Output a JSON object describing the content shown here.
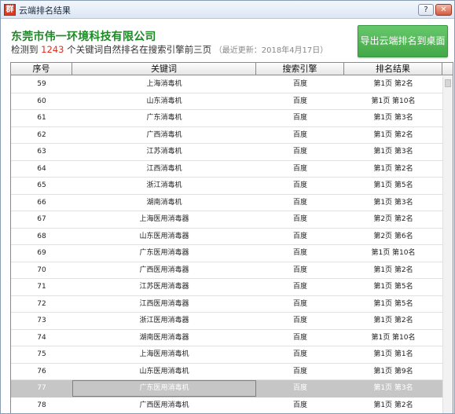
{
  "window": {
    "title": "云端排名结果",
    "app_icon_glyph": "群",
    "help_label": "?",
    "close_label": "✕"
  },
  "header": {
    "company": "东莞市伟一环境科技有限公司",
    "sub_prefix": "检测到",
    "keyword_count": "1243",
    "sub_suffix": "个关键词自然排名在搜索引擎前三页",
    "updated": "（最近更新：2018年4月17日）",
    "export_label": "导出云端排名到桌面"
  },
  "table": {
    "columns": [
      "序号",
      "关键词",
      "搜索引擎",
      "排名结果"
    ],
    "selected_index": 18,
    "rows": [
      [
        "59",
        "上海消毒机",
        "百度",
        "第1页 第2名"
      ],
      [
        "60",
        "山东消毒机",
        "百度",
        "第1页 第10名"
      ],
      [
        "61",
        "广东消毒机",
        "百度",
        "第1页 第3名"
      ],
      [
        "62",
        "广西消毒机",
        "百度",
        "第1页 第2名"
      ],
      [
        "63",
        "江苏消毒机",
        "百度",
        "第1页 第3名"
      ],
      [
        "64",
        "江西消毒机",
        "百度",
        "第1页 第2名"
      ],
      [
        "65",
        "浙江消毒机",
        "百度",
        "第1页 第5名"
      ],
      [
        "66",
        "湖南消毒机",
        "百度",
        "第1页 第3名"
      ],
      [
        "67",
        "上海医用消毒器",
        "百度",
        "第2页 第2名"
      ],
      [
        "68",
        "山东医用消毒器",
        "百度",
        "第2页 第6名"
      ],
      [
        "69",
        "广东医用消毒器",
        "百度",
        "第1页 第10名"
      ],
      [
        "70",
        "广西医用消毒器",
        "百度",
        "第1页 第2名"
      ],
      [
        "71",
        "江苏医用消毒器",
        "百度",
        "第1页 第5名"
      ],
      [
        "72",
        "江西医用消毒器",
        "百度",
        "第1页 第5名"
      ],
      [
        "73",
        "浙江医用消毒器",
        "百度",
        "第1页 第2名"
      ],
      [
        "74",
        "湖南医用消毒器",
        "百度",
        "第1页 第10名"
      ],
      [
        "75",
        "上海医用消毒机",
        "百度",
        "第1页 第1名"
      ],
      [
        "76",
        "山东医用消毒机",
        "百度",
        "第1页 第9名"
      ],
      [
        "77",
        "广东医用消毒机",
        "百度",
        "第1页 第3名"
      ],
      [
        "78",
        "广西医用消毒机",
        "百度",
        "第1页 第2名"
      ]
    ]
  }
}
